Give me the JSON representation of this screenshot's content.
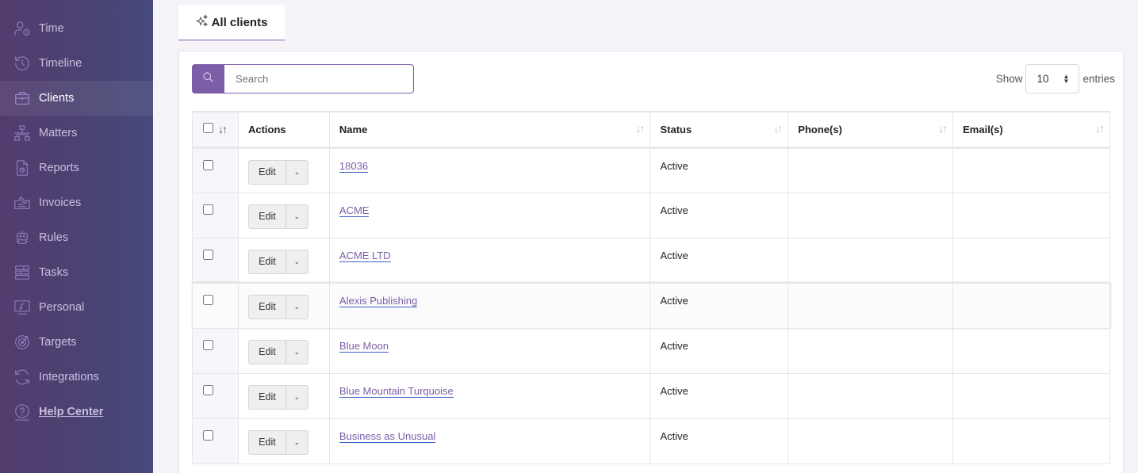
{
  "sidebar": {
    "items": [
      {
        "label": "Time",
        "icon": "user-clock-icon",
        "active": false
      },
      {
        "label": "Timeline",
        "icon": "history-icon",
        "active": false
      },
      {
        "label": "Clients",
        "icon": "briefcase-icon",
        "active": true
      },
      {
        "label": "Matters",
        "icon": "sitemap-icon",
        "active": false
      },
      {
        "label": "Reports",
        "icon": "file-chart-icon",
        "active": false
      },
      {
        "label": "Invoices",
        "icon": "invoice-icon",
        "active": false
      },
      {
        "label": "Rules",
        "icon": "robot-icon",
        "active": false
      },
      {
        "label": "Tasks",
        "icon": "tasks-icon",
        "active": false
      },
      {
        "label": "Personal",
        "icon": "monitor-music-icon",
        "active": false
      },
      {
        "label": "Targets",
        "icon": "target-icon",
        "active": false
      },
      {
        "label": "Integrations",
        "icon": "sync-icon",
        "active": false
      },
      {
        "label": "Help Center",
        "icon": "help-icon",
        "active": false
      }
    ]
  },
  "tab": {
    "label": "All clients",
    "icon": "sparkles-icon"
  },
  "search": {
    "placeholder": "Search",
    "value": ""
  },
  "length": {
    "show_label": "Show",
    "value": "10",
    "entries_label": "entries"
  },
  "table": {
    "columns": [
      "Actions",
      "Name",
      "Status",
      "Phone(s)",
      "Email(s)"
    ],
    "edit_label": "Edit",
    "rows": [
      {
        "name": "18036",
        "status": "Active",
        "phones": "",
        "emails": ""
      },
      {
        "name": "ACME",
        "status": "Active",
        "phones": "",
        "emails": ""
      },
      {
        "name": "ACME LTD",
        "status": "Active",
        "phones": "",
        "emails": ""
      },
      {
        "name": "Alexis Publishing",
        "status": "Active",
        "phones": "",
        "emails": "",
        "hovered": true
      },
      {
        "name": "Blue Moon",
        "status": "Active",
        "phones": "",
        "emails": ""
      },
      {
        "name": "Blue Mountain Turquoise",
        "status": "Active",
        "phones": "",
        "emails": ""
      },
      {
        "name": "Business as Unusual",
        "status": "Active",
        "phones": "",
        "emails": ""
      }
    ]
  }
}
